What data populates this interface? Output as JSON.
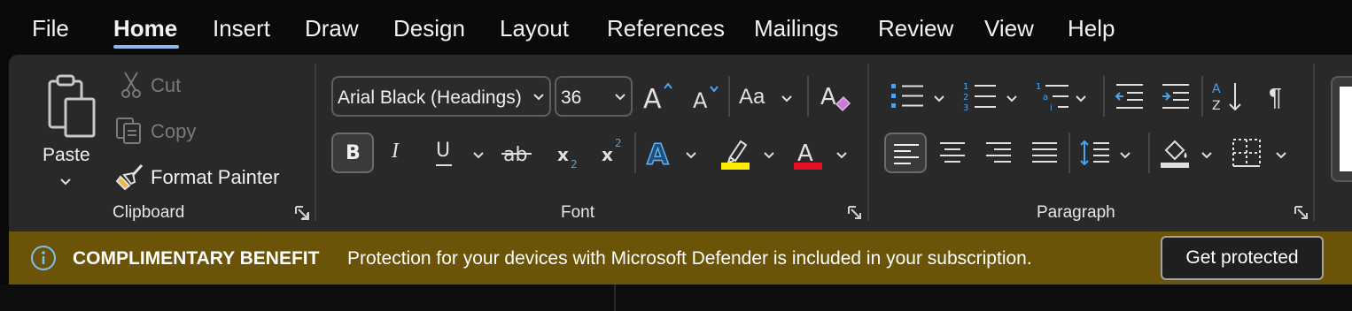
{
  "tabs": [
    {
      "label": "File",
      "active": false
    },
    {
      "label": "Home",
      "active": true
    },
    {
      "label": "Insert",
      "active": false
    },
    {
      "label": "Draw",
      "active": false
    },
    {
      "label": "Design",
      "active": false
    },
    {
      "label": "Layout",
      "active": false
    },
    {
      "label": "References",
      "active": false
    },
    {
      "label": "Mailings",
      "active": false
    },
    {
      "label": "Review",
      "active": false
    },
    {
      "label": "View",
      "active": false
    },
    {
      "label": "Help",
      "active": false
    }
  ],
  "clipboard": {
    "paste_label": "Paste",
    "cut_label": "Cut",
    "copy_label": "Copy",
    "format_painter_label": "Format Painter",
    "group_label": "Clipboard"
  },
  "font": {
    "font_name": "Arial Black (Headings)",
    "font_size": "36",
    "group_label": "Font",
    "case_glyph": "Aa",
    "highlight_color": "#ffee00",
    "font_color": "#e81123"
  },
  "paragraph": {
    "group_label": "Paragraph",
    "pilcrow": "¶"
  },
  "banner": {
    "title": "COMPLIMENTARY BENEFIT",
    "message": "Protection for your devices with Microsoft Defender is included in your subscription.",
    "button_label": "Get protected"
  },
  "colors": {
    "accent": "#8fb8ec",
    "ribbon_bg": "#292929",
    "banner_bg": "#6b5407",
    "icon_blue": "#4aa3f0"
  }
}
